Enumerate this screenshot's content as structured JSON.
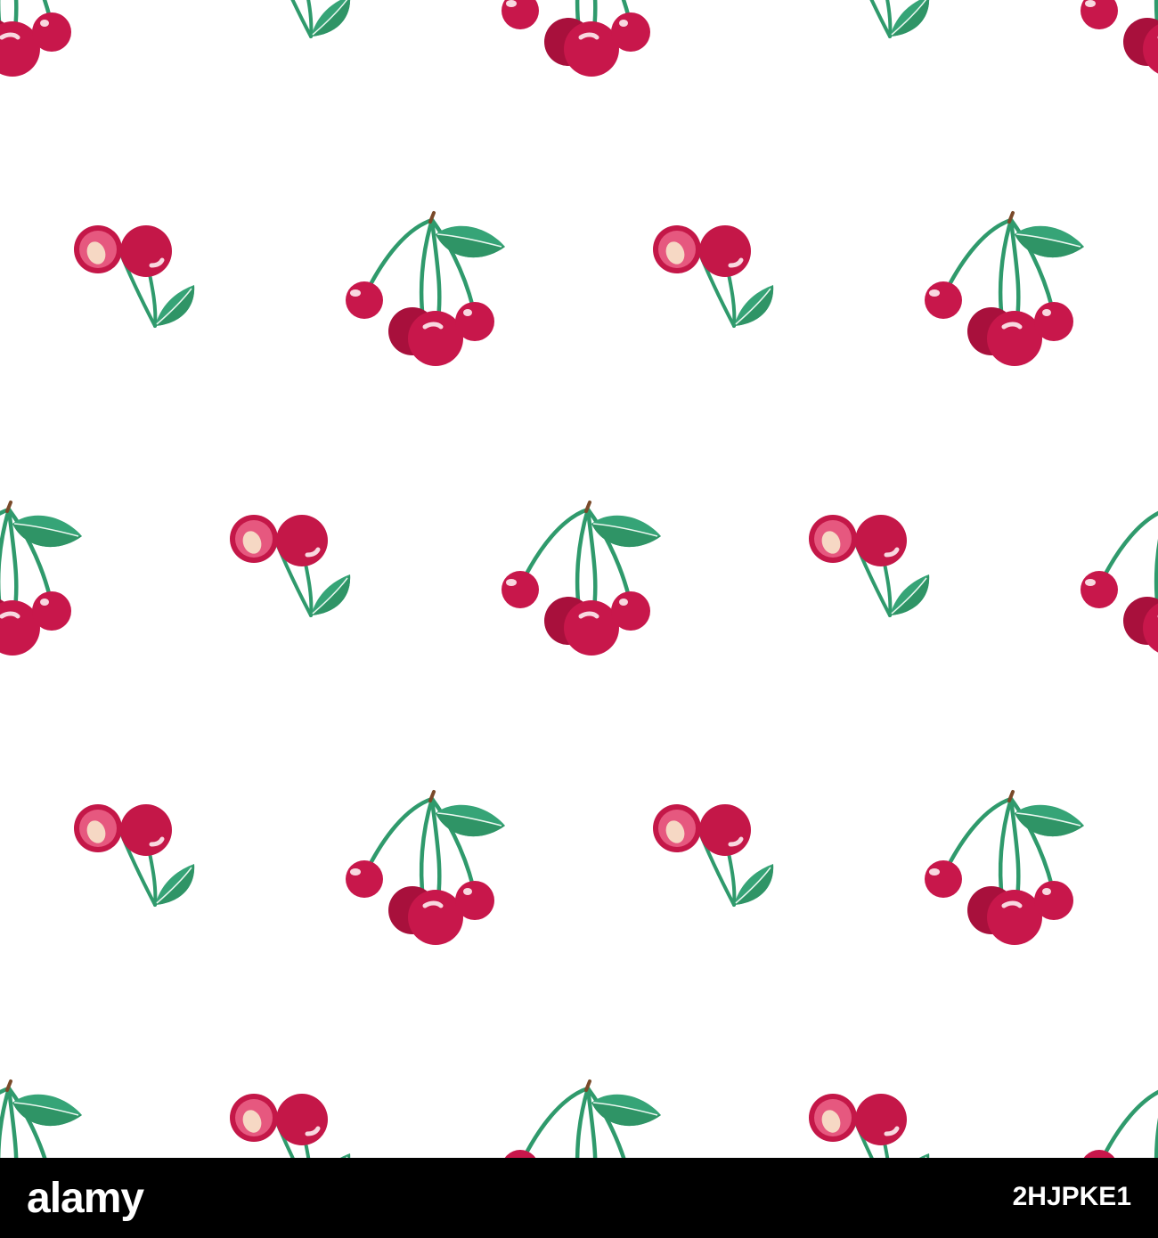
{
  "pattern": {
    "motifs": [
      "cherry-cluster-motif",
      "cut-cherry-motif"
    ],
    "colors": {
      "background": "#ffffff",
      "cherry": "#c8174b",
      "cherry_dark": "#a8103c",
      "cherry_cut": "#c41748",
      "cherry_inner": "#e6587f",
      "pit": "#f6d8c4",
      "highlight": "#f8d8e0",
      "stem": "#2f9a6c",
      "leaf": "#36a477",
      "leaf_light": "#52bb8c",
      "leaf_vein": "#eaf7ef",
      "bar": "#000000"
    }
  },
  "watermark": {
    "logo_text": "alamy",
    "image_id": "2HJPKE1"
  }
}
